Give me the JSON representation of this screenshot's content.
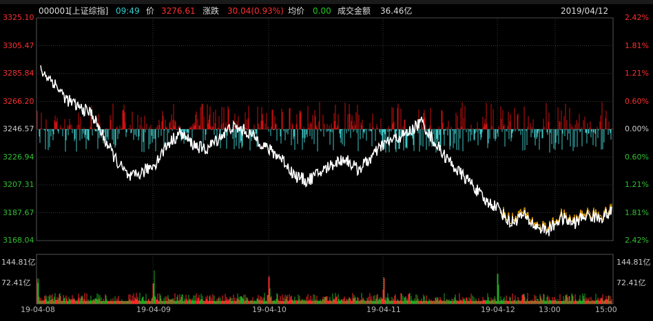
{
  "header": {
    "code": "000001",
    "name": "[上证综指]",
    "time": "09:49",
    "price_label": "价",
    "price": "3276.61",
    "change_label": "涨跌",
    "change": "30.04(0.93%)",
    "avg_label": "均价",
    "avg": "0.00",
    "amount_label": "成交金额",
    "amount": "36.46亿",
    "date": "2019/04/12"
  },
  "left_axis": [
    "3325.10",
    "3305.47",
    "3285.84",
    "3266.20",
    "3246.57",
    "3226.94",
    "3207.31",
    "3187.67",
    "3168.04"
  ],
  "right_axis": [
    "2.42%",
    "1.81%",
    "1.21%",
    "0.60%",
    "0.00%",
    "0.60%",
    "1.21%",
    "1.81%",
    "2.42%"
  ],
  "volume_axis_left": [
    "144.81亿",
    "72.41亿"
  ],
  "volume_axis_right": [
    "144.81亿",
    "72.41亿"
  ],
  "x_labels": [
    "19-04-08",
    "19-04-09",
    "19-04-10",
    "19-04-11",
    "19-04-12",
    "13:00",
    "15:00"
  ],
  "colors": {
    "up": "#ff3030",
    "down": "#30d0d0",
    "price_line": "#ffffff",
    "avg_line": "#ffb000",
    "bar_up": "#cc1010",
    "bar_down": "#40c8c8",
    "vol_up": "#ff2a2a",
    "vol_down": "#22aa22",
    "grid": "#3a3a3a"
  },
  "chart_data": {
    "type": "line",
    "ylim": [
      3168.04,
      3325.1
    ],
    "base": 3246.57,
    "x": [
      "19-04-08",
      "19-04-09",
      "19-04-10",
      "19-04-11",
      "19-04-12"
    ],
    "series": [
      {
        "values": [
          3288,
          3280,
          3268,
          3262,
          3258,
          3240,
          3224,
          3212,
          3216,
          3222,
          3236,
          3244,
          3236,
          3232,
          3240,
          3248,
          3246,
          3240,
          3232,
          3226,
          3214,
          3210,
          3216,
          3222,
          3226,
          3218,
          3226,
          3236,
          3240,
          3244,
          3252,
          3238,
          3226,
          3216,
          3208,
          3196,
          3192,
          3180,
          3186,
          3178,
          3175,
          3184,
          3180,
          3186,
          3184,
          3188
        ]
      }
    ]
  }
}
